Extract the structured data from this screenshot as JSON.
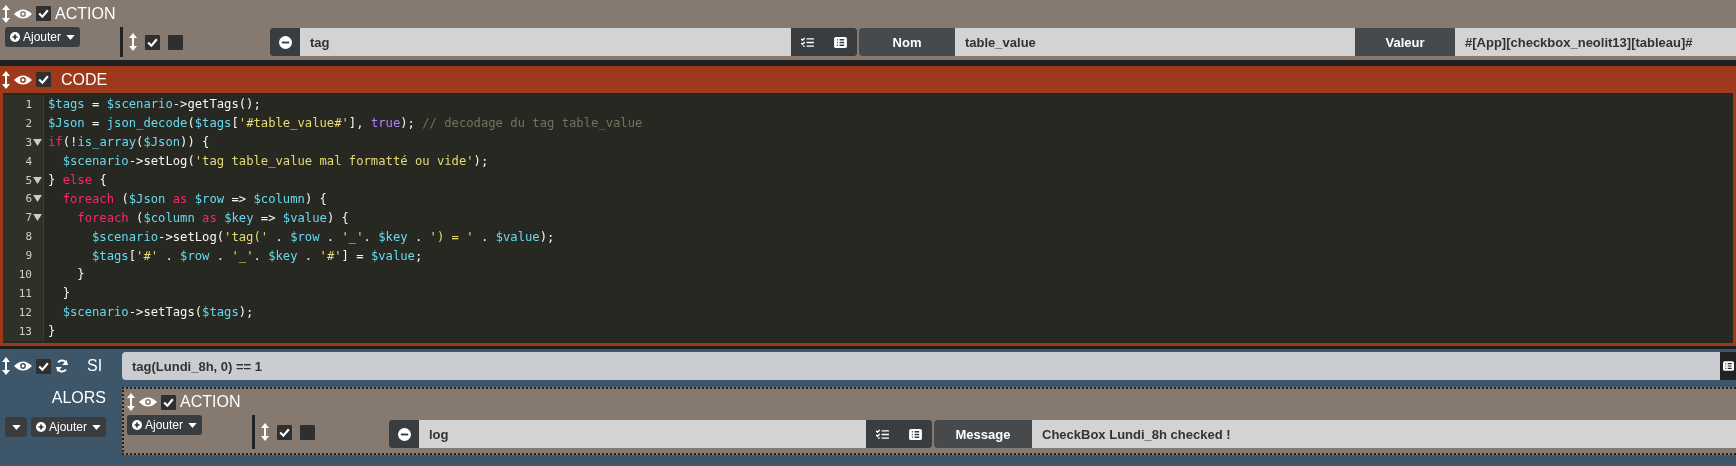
{
  "action_block": {
    "title": "ACTION",
    "checked": true,
    "add_button": "Ajouter",
    "action": {
      "checked": true,
      "option_checked": false,
      "command": "tag",
      "params": [
        {
          "label": "Nom",
          "value": "table_value"
        },
        {
          "label": "Valeur",
          "value": "#[App][checkbox_neolit13][tableau]#"
        }
      ]
    }
  },
  "code_block": {
    "title": "CODE",
    "checked": true,
    "lines": [
      {
        "number": "1",
        "foldable": false,
        "tokens": [
          {
            "kind": "var",
            "text": "$tags"
          },
          {
            "kind": "plain",
            "text": " = "
          },
          {
            "kind": "var",
            "text": "$scenario"
          },
          {
            "kind": "plain",
            "text": "->getTags();"
          }
        ]
      },
      {
        "number": "2",
        "foldable": false,
        "tokens": [
          {
            "kind": "var",
            "text": "$Json"
          },
          {
            "kind": "plain",
            "text": " = "
          },
          {
            "kind": "func",
            "text": "json_decode"
          },
          {
            "kind": "plain",
            "text": "("
          },
          {
            "kind": "var",
            "text": "$tags"
          },
          {
            "kind": "plain",
            "text": "["
          },
          {
            "kind": "string",
            "text": "'#table_value#'"
          },
          {
            "kind": "plain",
            "text": "], "
          },
          {
            "kind": "bool",
            "text": "true"
          },
          {
            "kind": "plain",
            "text": "); "
          },
          {
            "kind": "comment",
            "text": "// decodage du tag table_value"
          }
        ]
      },
      {
        "number": "3",
        "foldable": true,
        "tokens": [
          {
            "kind": "keyword",
            "text": "if"
          },
          {
            "kind": "plain",
            "text": "(!"
          },
          {
            "kind": "func",
            "text": "is_array"
          },
          {
            "kind": "plain",
            "text": "("
          },
          {
            "kind": "var",
            "text": "$Json"
          },
          {
            "kind": "plain",
            "text": ")) {"
          }
        ]
      },
      {
        "number": "4",
        "foldable": false,
        "tokens": [
          {
            "kind": "var",
            "text": "  $scenario"
          },
          {
            "kind": "plain",
            "text": "->setLog("
          },
          {
            "kind": "string",
            "text": "'tag table_value mal formatté ou vide'"
          },
          {
            "kind": "plain",
            "text": ");"
          }
        ]
      },
      {
        "number": "5",
        "foldable": true,
        "tokens": [
          {
            "kind": "plain",
            "text": "} "
          },
          {
            "kind": "keyword",
            "text": "else"
          },
          {
            "kind": "plain",
            "text": " {"
          }
        ]
      },
      {
        "number": "6",
        "foldable": true,
        "tokens": [
          {
            "kind": "keyword",
            "text": "  foreach"
          },
          {
            "kind": "plain",
            "text": " ("
          },
          {
            "kind": "var",
            "text": "$Json"
          },
          {
            "kind": "keyword",
            "text": " as "
          },
          {
            "kind": "var",
            "text": "$row"
          },
          {
            "kind": "plain",
            "text": " => "
          },
          {
            "kind": "var",
            "text": "$column"
          },
          {
            "kind": "plain",
            "text": ") {"
          }
        ]
      },
      {
        "number": "7",
        "foldable": true,
        "tokens": [
          {
            "kind": "keyword",
            "text": "    foreach"
          },
          {
            "kind": "plain",
            "text": " ("
          },
          {
            "kind": "var",
            "text": "$column"
          },
          {
            "kind": "keyword",
            "text": " as "
          },
          {
            "kind": "var",
            "text": "$key"
          },
          {
            "kind": "plain",
            "text": " => "
          },
          {
            "kind": "var",
            "text": "$value"
          },
          {
            "kind": "plain",
            "text": ") {"
          }
        ]
      },
      {
        "number": "8",
        "foldable": false,
        "tokens": [
          {
            "kind": "var",
            "text": "      $scenario"
          },
          {
            "kind": "plain",
            "text": "->setLog("
          },
          {
            "kind": "string",
            "text": "'tag('"
          },
          {
            "kind": "plain",
            "text": " . "
          },
          {
            "kind": "var",
            "text": "$row"
          },
          {
            "kind": "plain",
            "text": " . "
          },
          {
            "kind": "string",
            "text": "'_'"
          },
          {
            "kind": "plain",
            "text": ". "
          },
          {
            "kind": "var",
            "text": "$key"
          },
          {
            "kind": "plain",
            "text": " . "
          },
          {
            "kind": "string",
            "text": "') = '"
          },
          {
            "kind": "plain",
            "text": " . "
          },
          {
            "kind": "var",
            "text": "$value"
          },
          {
            "kind": "plain",
            "text": ");"
          }
        ]
      },
      {
        "number": "9",
        "foldable": false,
        "tokens": [
          {
            "kind": "var",
            "text": "      $tags"
          },
          {
            "kind": "plain",
            "text": "["
          },
          {
            "kind": "string",
            "text": "'#'"
          },
          {
            "kind": "plain",
            "text": " . "
          },
          {
            "kind": "var",
            "text": "$row"
          },
          {
            "kind": "plain",
            "text": " . "
          },
          {
            "kind": "string",
            "text": "'_'"
          },
          {
            "kind": "plain",
            "text": ". "
          },
          {
            "kind": "var",
            "text": "$key"
          },
          {
            "kind": "plain",
            "text": " . "
          },
          {
            "kind": "string",
            "text": "'#'"
          },
          {
            "kind": "plain",
            "text": "] = "
          },
          {
            "kind": "var",
            "text": "$value"
          },
          {
            "kind": "plain",
            "text": ";"
          }
        ]
      },
      {
        "number": "10",
        "foldable": false,
        "tokens": [
          {
            "kind": "plain",
            "text": "    }"
          }
        ]
      },
      {
        "number": "11",
        "foldable": false,
        "tokens": [
          {
            "kind": "plain",
            "text": "  }"
          }
        ]
      },
      {
        "number": "12",
        "foldable": false,
        "tokens": [
          {
            "kind": "var",
            "text": "  $scenario"
          },
          {
            "kind": "plain",
            "text": "->setTags("
          },
          {
            "kind": "var",
            "text": "$tags"
          },
          {
            "kind": "plain",
            "text": ");"
          }
        ]
      },
      {
        "number": "13",
        "foldable": false,
        "tokens": [
          {
            "kind": "plain",
            "text": "}"
          }
        ]
      }
    ]
  },
  "if_block": {
    "title": "SI",
    "checked": true,
    "condition": "tag(Lundi_8h, 0) == 1",
    "then_label": "ALORS",
    "add_button": "Ajouter",
    "then_block": {
      "title": "ACTION",
      "checked": true,
      "add_button": "Ajouter",
      "action": {
        "checked": true,
        "option_checked": false,
        "command": "log",
        "params": [
          {
            "label": "Message",
            "value": "CheckBox Lundi_8h checked !"
          }
        ]
      }
    }
  }
}
